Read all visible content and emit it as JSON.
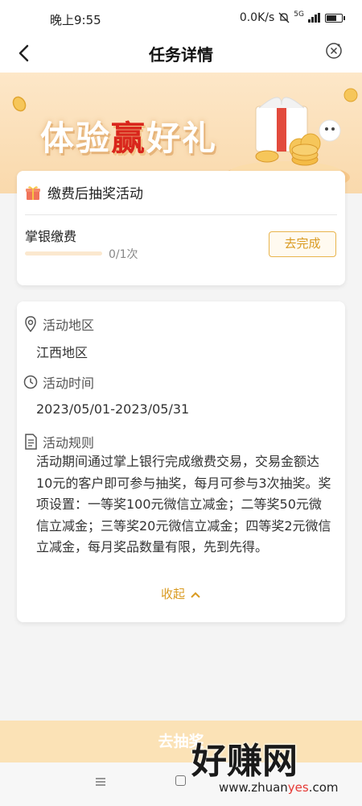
{
  "status_bar": {
    "time": "晚上9:55",
    "net_speed": "0.0K/s",
    "network_type": "5G"
  },
  "nav": {
    "title": "任务详情",
    "back_icon": "chevron-left-icon",
    "close_icon": "close-circle-icon"
  },
  "banner": {
    "title_part1": "体验",
    "title_highlight": "赢",
    "title_part2": "好礼",
    "accent_color": "#d9261c"
  },
  "task": {
    "header_title": "缴费后抽奖活动",
    "name": "掌银缴费",
    "progress_text": "0/1次",
    "progress_fraction": 0,
    "button_label": "去完成"
  },
  "activity": {
    "region_label": "活动地区",
    "region_value": "江西地区",
    "time_label": "活动时间",
    "time_value": "2023/05/01-2023/05/31",
    "rules_label": "活动规则",
    "rules_text": "活动期间通过掌上银行完成缴费交易，交易金额达10元的客户即可参与抽奖，每月可参与3次抽奖。奖项设置：一等奖100元微信立减金；二等奖50元微信立减金；三等奖20元微信立减金；四等奖2元微信立减金，每月奖品数量有限，先到先得。",
    "collapse_label": "收起"
  },
  "bottom": {
    "draw_button": "去抽奖"
  },
  "watermark": {
    "text": "好赚网",
    "url_part1": "www.zhuan",
    "url_highlight": "yes",
    "url_part2": ".com"
  }
}
